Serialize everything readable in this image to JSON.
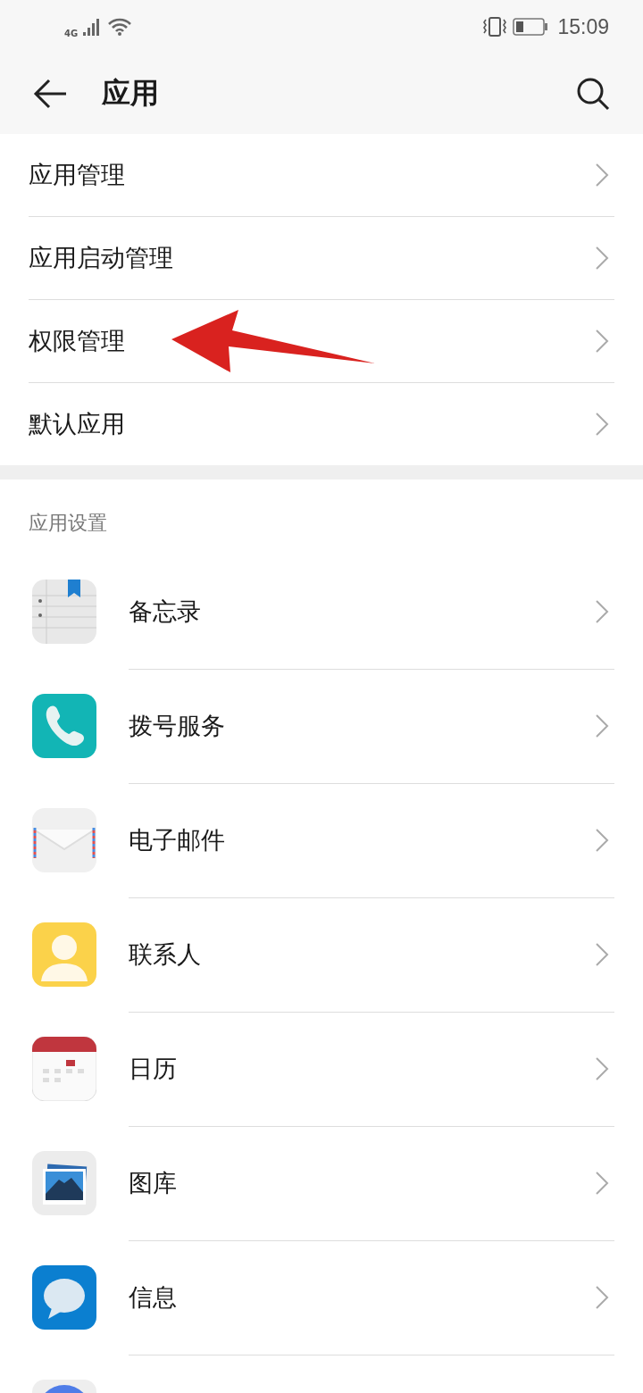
{
  "status_bar": {
    "network": "4G",
    "time": "15:09"
  },
  "header": {
    "title": "应用"
  },
  "menu": [
    {
      "label": "应用管理"
    },
    {
      "label": "应用启动管理"
    },
    {
      "label": "权限管理",
      "annotated": true
    },
    {
      "label": "默认应用"
    }
  ],
  "section": {
    "title": "应用设置"
  },
  "apps": [
    {
      "kind": "notes",
      "name": "备忘录"
    },
    {
      "kind": "phone",
      "name": "拨号服务"
    },
    {
      "kind": "mail",
      "name": "电子邮件"
    },
    {
      "kind": "contacts",
      "name": "联系人"
    },
    {
      "kind": "calendar",
      "name": "日历"
    },
    {
      "kind": "gallery",
      "name": "图库"
    },
    {
      "kind": "messages",
      "name": "信息"
    },
    {
      "kind": "round"
    }
  ]
}
